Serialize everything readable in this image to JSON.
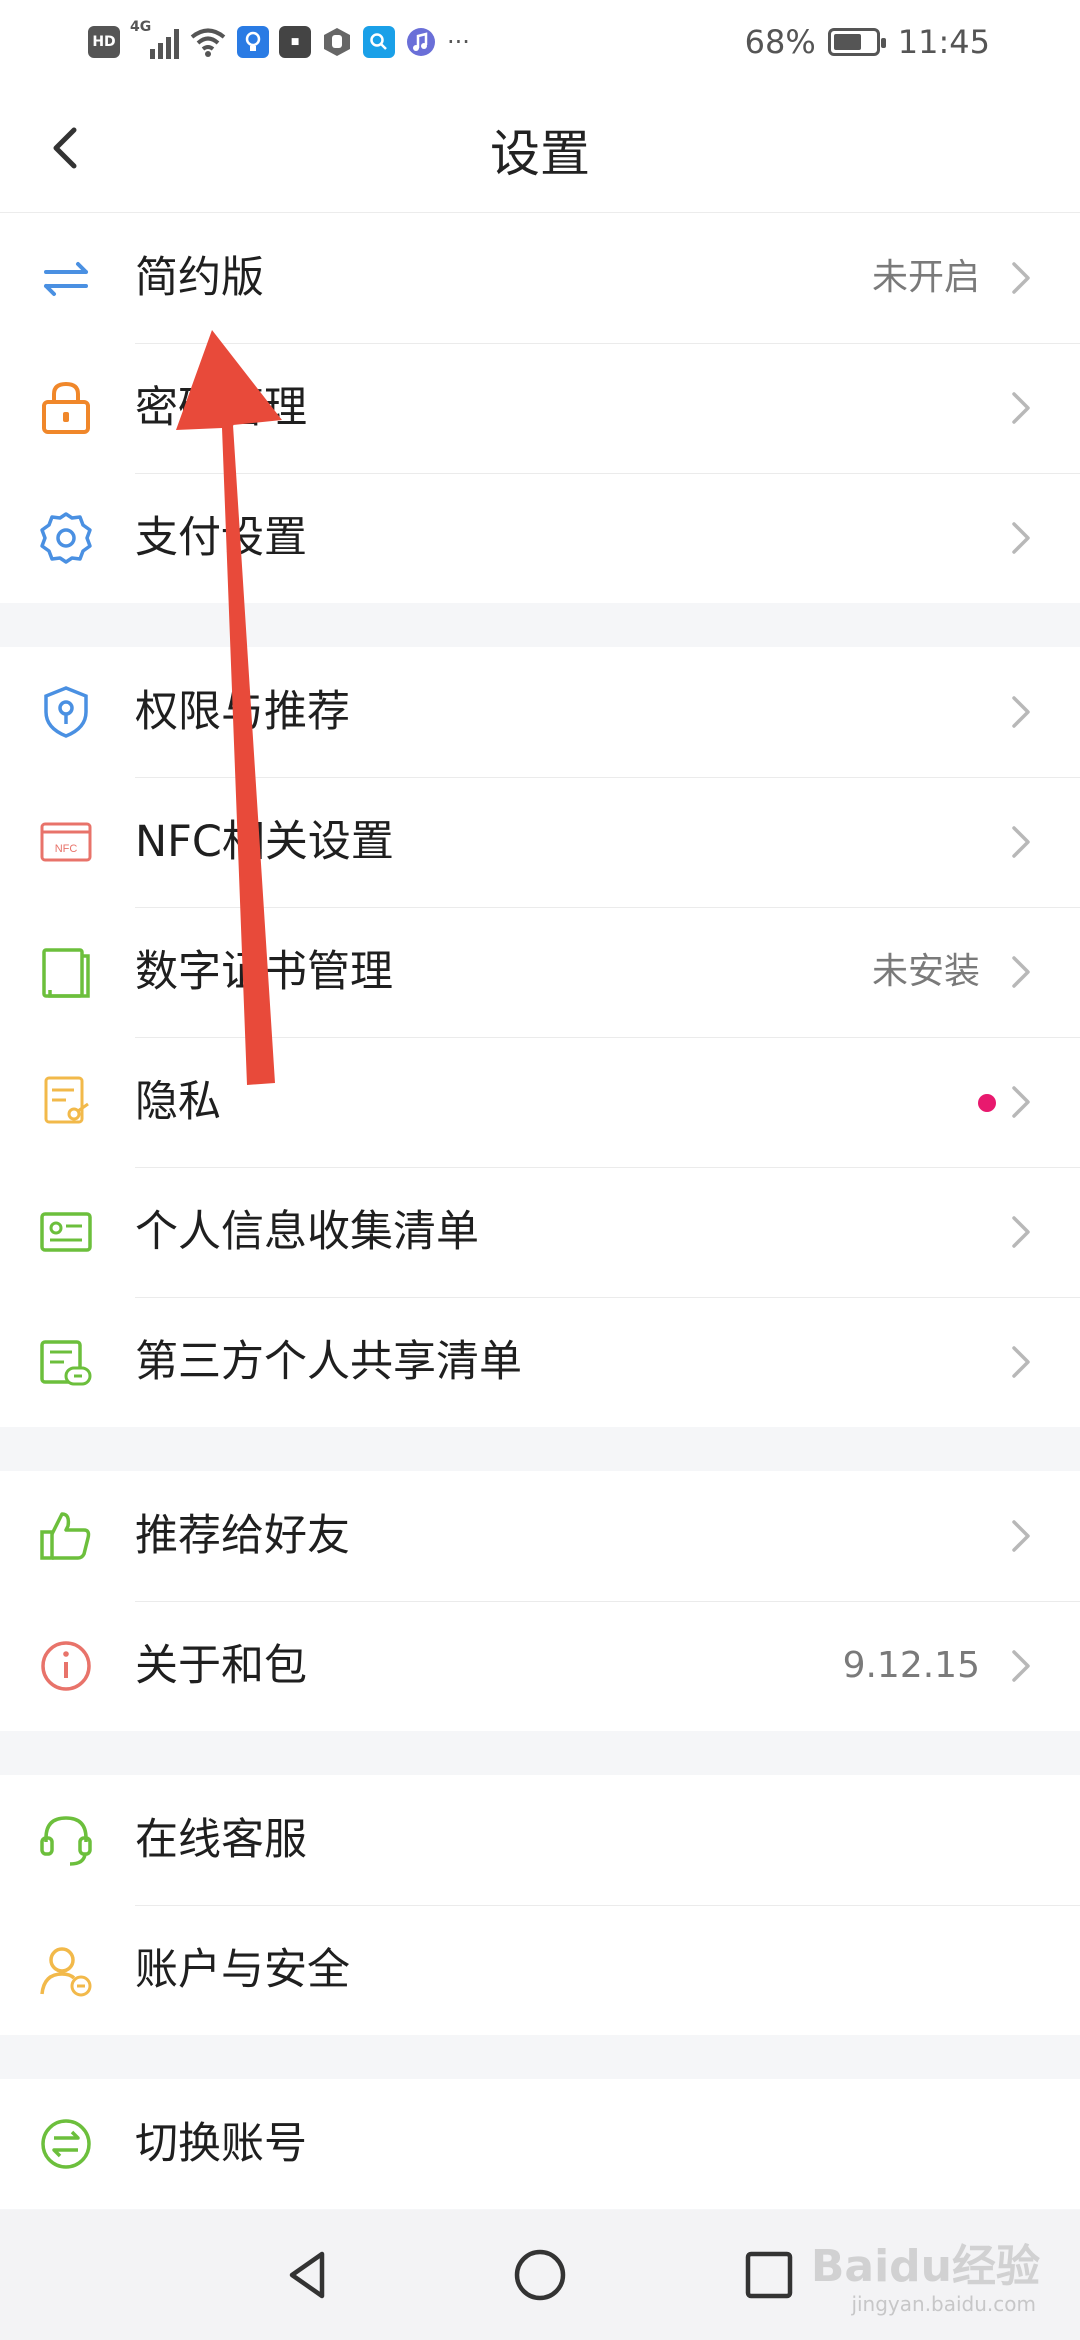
{
  "status_bar": {
    "hd_badge": "HD",
    "network": "4G",
    "battery_percent_label": "68%",
    "battery_level": 0.68,
    "time": "11:45",
    "more": "···"
  },
  "header": {
    "title": "设置"
  },
  "groups": [
    {
      "items": [
        {
          "label": "简约版",
          "value": "未开启",
          "icon": "swap-arrows-icon",
          "icon_color": "#4a90e2"
        },
        {
          "label": "密码管理",
          "value": "",
          "icon": "lock-icon",
          "icon_color": "#f0872a"
        },
        {
          "label": "支付设置",
          "value": "",
          "icon": "gear-icon",
          "icon_color": "#4a90e2"
        }
      ]
    },
    {
      "items": [
        {
          "label": "权限与推荐",
          "value": "",
          "icon": "shield-key-icon",
          "icon_color": "#4a90e2"
        },
        {
          "label": "NFC相关设置",
          "value": "",
          "icon": "nfc-card-icon",
          "icon_color": "#e8736a"
        },
        {
          "label": "数字证书管理",
          "value": "未安装",
          "icon": "certificate-icon",
          "icon_color": "#6cbf3c"
        },
        {
          "label": "隐私",
          "value": "",
          "icon": "privacy-doc-icon",
          "icon_color": "#f2b94a"
        },
        {
          "label": "个人信息收集清单",
          "value": "",
          "icon": "id-card-icon",
          "icon_color": "#6cbf3c"
        },
        {
          "label": "第三方个人共享清单",
          "value": "",
          "icon": "share-list-icon",
          "icon_color": "#6cbf3c"
        }
      ]
    },
    {
      "items": [
        {
          "label": "推荐给好友",
          "value": "",
          "icon": "thumbs-up-icon",
          "icon_color": "#6cbf3c"
        },
        {
          "label": "关于和包",
          "value": "9.12.15",
          "icon": "info-icon",
          "icon_color": "#e8736a"
        }
      ]
    },
    {
      "items": [
        {
          "label": "在线客服",
          "value": "",
          "icon": "headset-icon",
          "icon_color": "#6cbf3c"
        },
        {
          "label": "账户与安全",
          "value": "",
          "icon": "user-shield-icon",
          "icon_color": "#f2b94a"
        }
      ]
    },
    {
      "items": [
        {
          "label": "切换账号",
          "value": "",
          "icon": "switch-account-icon",
          "icon_color": "#6cbf3c"
        }
      ]
    }
  ],
  "nav_bar": {
    "back": "back-triangle-icon",
    "home": "home-circle-icon",
    "recents": "recents-square-icon"
  },
  "watermark": {
    "text": "Baidu经验",
    "sub": "jingyan.baidu.com"
  },
  "colors": {
    "arrow": "#e84a3a",
    "badge_dot": "#e8196e"
  }
}
